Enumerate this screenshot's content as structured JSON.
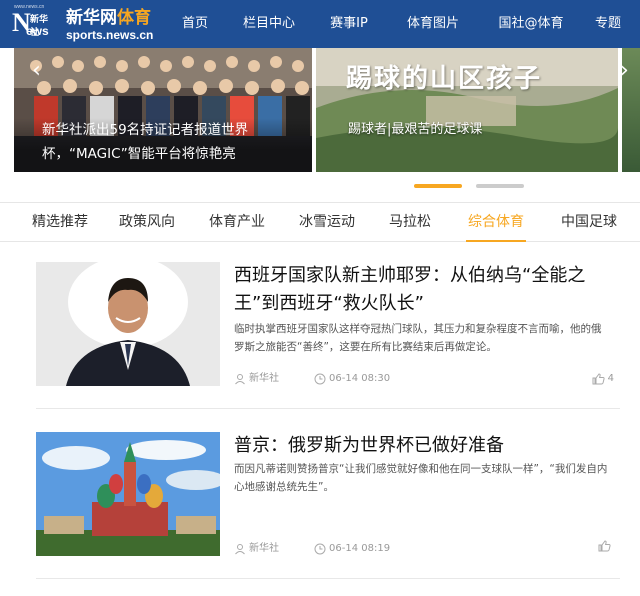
{
  "header": {
    "logo_tiny": "www.news.cn",
    "logo_n": "N",
    "logo_cn": "新华社",
    "logo_ews": "ews",
    "site_name": "新华网",
    "site_section": "体育",
    "site_url": "sports.news.cn",
    "nav": [
      "首页",
      "栏目中心",
      "赛事IP",
      "体育图片",
      "国社@体育",
      "专题"
    ]
  },
  "carousel": {
    "slides": [
      {
        "caption": "新华社派出59名持证记者报道世界杯，“MAGIC”智能平台将惊艳亮"
      },
      {
        "overlay": "踢球的山区孩子",
        "caption": "踢球者|最艰苦的足球课"
      }
    ],
    "active_index": 0,
    "dot_count": 2
  },
  "tabs": {
    "items": [
      "精选推荐",
      "政策风向",
      "体育产业",
      "冰雪运动",
      "马拉松",
      "综合体育",
      "中国足球"
    ],
    "active": "综合体育"
  },
  "articles": [
    {
      "title": "西班牙国家队新主帅耶罗：从伯纳乌“全能之王”到西班牙“救火队长”",
      "summary": "临时执掌西班牙国家队这样夺冠热门球队，其压力和复杂程度不言而喻，他的俄罗斯之旅能否“善终”，这要在所有比赛结束后再做定论。",
      "source": "新华社",
      "time": "06-14 08:30",
      "likes": "4"
    },
    {
      "title": "普京：俄罗斯为世界杯已做好准备",
      "summary": "而因凡蒂诺则赞扬普京“让我们感觉就好像和他在同一支球队一样”，“我们发自内心地感谢总统先生”。",
      "source": "新华社",
      "time": "06-14 08:19",
      "likes": ""
    }
  ],
  "colors": {
    "header_bg": "#1f4f95",
    "accent": "#f7a721"
  }
}
